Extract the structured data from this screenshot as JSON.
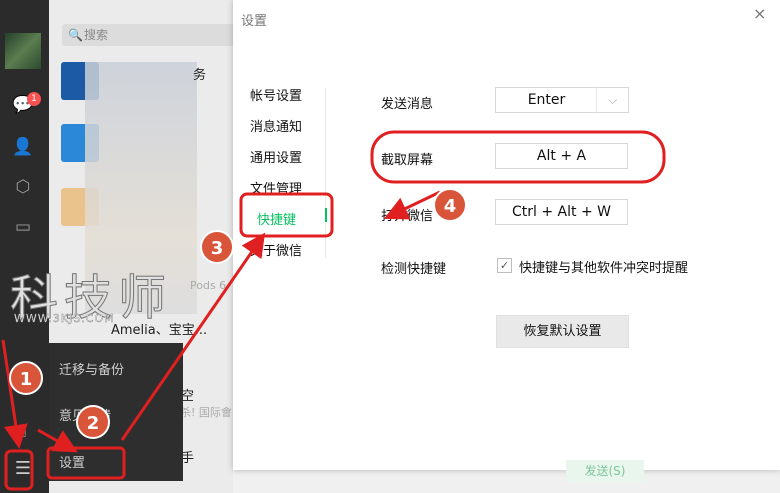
{
  "sidebar": {
    "badge_count": "1"
  },
  "search": {
    "placeholder": "搜索"
  },
  "chats": [
    {
      "title": "务"
    },
    {
      "title": "Pods 6"
    },
    {
      "title": "Amelia、宝宝..."
    },
    {
      "title": "空",
      "sub": "杀! 国际會"
    },
    {
      "title": "手"
    }
  ],
  "menu": {
    "items": [
      "迁移与备份",
      "意见反馈",
      "设置"
    ]
  },
  "dialog": {
    "title": "设置",
    "close": "×",
    "nav": [
      "帐号设置",
      "消息通知",
      "通用设置",
      "文件管理",
      "快捷键",
      "关于微信"
    ],
    "rows": {
      "send_label": "发送消息",
      "send_value": "Enter",
      "screenshot_label": "截取屏幕",
      "screenshot_value": "Alt + A",
      "open_label": "打开微信",
      "open_value": "Ctrl + Alt + W",
      "detect_label": "检测快捷键",
      "detect_check": "快捷键与其他软件冲突时提醒"
    },
    "restore_button": "恢复默认设置",
    "send_button": "发送(S)"
  },
  "watermark": {
    "text": "科技师",
    "url": "WWW.3KJS.COM"
  },
  "callouts": [
    "1",
    "2",
    "3",
    "4"
  ],
  "colors": {
    "accent": "#07c160",
    "annotation_red": "#e02020",
    "callout": "#d9553a"
  }
}
